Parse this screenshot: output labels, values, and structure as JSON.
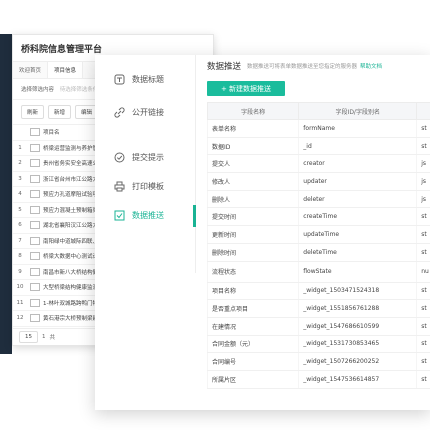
{
  "background": {
    "app_title": "桥科院信息管理平台",
    "tabs": [
      "欢迎首页",
      "项目信息"
    ],
    "filter_label": "选择筛选内容",
    "filter_hint": "待选择筛选条件",
    "toolbar": [
      "刷新",
      "新增",
      "编辑"
    ],
    "column_header": "项目名",
    "rows": [
      {
        "n": "1",
        "t": "桥梁运营监测与养护管理系统"
      },
      {
        "n": "2",
        "t": "贵州省务实安全高速公路桥梁"
      },
      {
        "n": "3",
        "t": "浙江省台州市江公路大桥"
      },
      {
        "n": "4",
        "t": "预应力孔道摩阻试验项目"
      },
      {
        "n": "5",
        "t": "预应力混凝土预制箱梁架设"
      },
      {
        "n": "6",
        "t": "湖北省襄阳汉江公路大桥工程"
      },
      {
        "n": "7",
        "t": "南阳绿中道城际四联、第五"
      },
      {
        "n": "8",
        "t": "桥梁大数据中心测试计划项目"
      },
      {
        "n": "9",
        "t": "南昌市新八大桥结构健康监测"
      },
      {
        "n": "10",
        "t": "大型桥梁结构健康监测系统仪"
      },
      {
        "n": "11",
        "t": "1-林叶双城路跨鸭门特大桥"
      },
      {
        "n": "12",
        "t": "黄石港宗大桥预制梁建设"
      }
    ],
    "footer": {
      "page_size": "15",
      "page": "1",
      "of": "共"
    }
  },
  "nav": [
    {
      "label": "数据标题",
      "icon": "title-icon"
    },
    {
      "label": "公开链接",
      "icon": "link-icon"
    },
    {
      "label": "提交提示",
      "icon": "check-circle-icon"
    },
    {
      "label": "打印模板",
      "icon": "printer-icon"
    },
    {
      "label": "数据推送",
      "icon": "checkbox-icon",
      "active": true
    }
  ],
  "panel": {
    "title": "数据推送",
    "description": "数据推送可将表单数据推送至您指定的服务器",
    "help_link": "帮助文档",
    "new_button": "+ 新建数据推送",
    "columns": [
      "字段名称",
      "字段ID/字段别名",
      ""
    ],
    "rows": [
      {
        "name": "表单名称",
        "id": "formName",
        "type": "st"
      },
      {
        "name": "数据ID",
        "id": "_id",
        "type": "st"
      },
      {
        "name": "提交人",
        "id": "creator",
        "type": "js"
      },
      {
        "name": "修改人",
        "id": "updater",
        "type": "js"
      },
      {
        "name": "删除人",
        "id": "deleter",
        "type": "js"
      },
      {
        "name": "提交时间",
        "id": "createTime",
        "type": "st"
      },
      {
        "name": "更新时间",
        "id": "updateTime",
        "type": "st"
      },
      {
        "name": "删除时间",
        "id": "deleteTime",
        "type": "st"
      },
      {
        "name": "流程状态",
        "id": "flowState",
        "type": "nu"
      },
      {
        "name": "项目名称",
        "id": "_widget_1503471524318",
        "type": "st"
      },
      {
        "name": "是否重点项目",
        "id": "_widget_1551856761288",
        "type": "st"
      },
      {
        "name": "在建情况",
        "id": "_widget_1547686610599",
        "type": "st"
      },
      {
        "name": "合同金额（元）",
        "id": "_widget_1531730853465",
        "type": "st"
      },
      {
        "name": "合同编号",
        "id": "_widget_1507266200252",
        "type": "st"
      },
      {
        "name": "所属片区",
        "id": "_widget_1547536614857",
        "type": "st"
      }
    ]
  },
  "colors": {
    "accent": "#1abc9c",
    "sidebar": "#1f2d3d"
  }
}
